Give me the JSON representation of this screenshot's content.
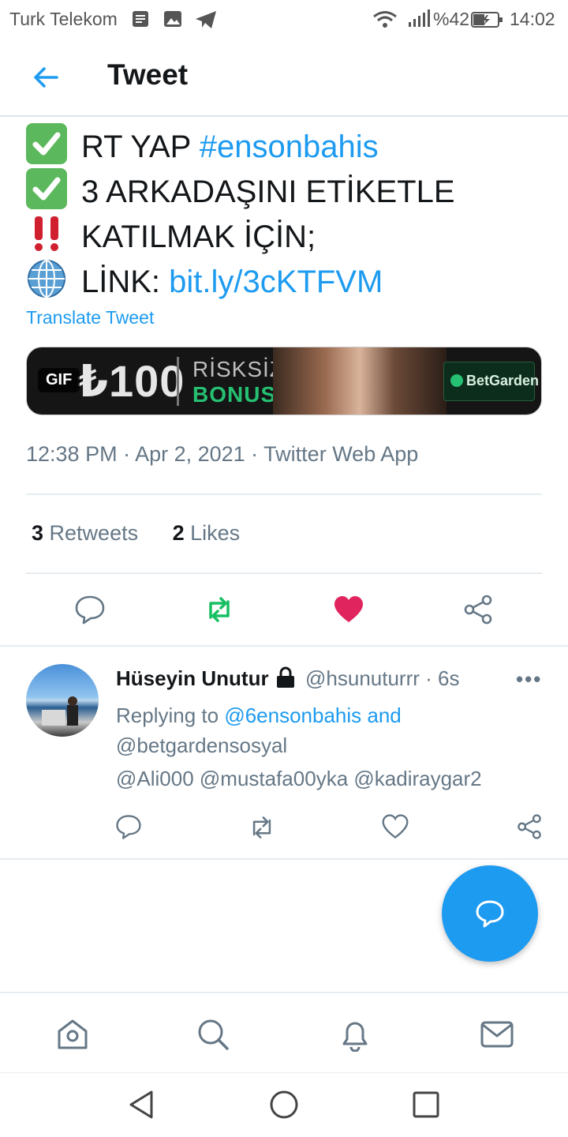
{
  "status_bar": {
    "carrier": "Turk Telekom",
    "battery": "%42",
    "time": "14:02",
    "icons": [
      "notes-icon",
      "image-icon",
      "telegram-icon",
      "wifi-icon",
      "signal-icon",
      "battery-icon"
    ]
  },
  "header": {
    "title": "Tweet"
  },
  "tweet": {
    "lines": [
      {
        "emoji": "check-mark-icon",
        "text": "RT YAP ",
        "link": "#ensonbahis"
      },
      {
        "emoji": "check-mark-icon",
        "text": "3 ARKADAŞINI ETİKETLE",
        "link": ""
      },
      {
        "emoji": "double-exclamation-icon",
        "text": "KATILMAK İÇİN;",
        "link": ""
      },
      {
        "emoji": "globe-icon",
        "text": "LİNK: ",
        "link": "bit.ly/3cKTFVM"
      }
    ],
    "translate_label": "Translate Tweet",
    "media": {
      "gif_badge": "GIF",
      "amount": "₺100",
      "line1": "RİSKSİZ",
      "line2": "BONUS",
      "brand": "BetGarden"
    },
    "meta": "12:38 PM · Apr 2, 2021 · Twitter Web App",
    "retweets_count": "3",
    "retweets_label": " Retweets",
    "likes_count": "2",
    "likes_label": " Likes"
  },
  "reply": {
    "name": "Hüseyin Unutur",
    "handle": "@hsunuturrr · 6s",
    "replying_to_prefix": "Replying to ",
    "replying_to_1": "@6ensonbahis and",
    "replying_to_2": "@betgardensosyal",
    "mentions": "@Ali000 @mustafa00yka @kadiraygar2",
    "more": "•••"
  },
  "colors": {
    "accent": "#1d9bf0",
    "retweet": "#17bf63",
    "like": "#e0245e",
    "muted": "#657786"
  }
}
